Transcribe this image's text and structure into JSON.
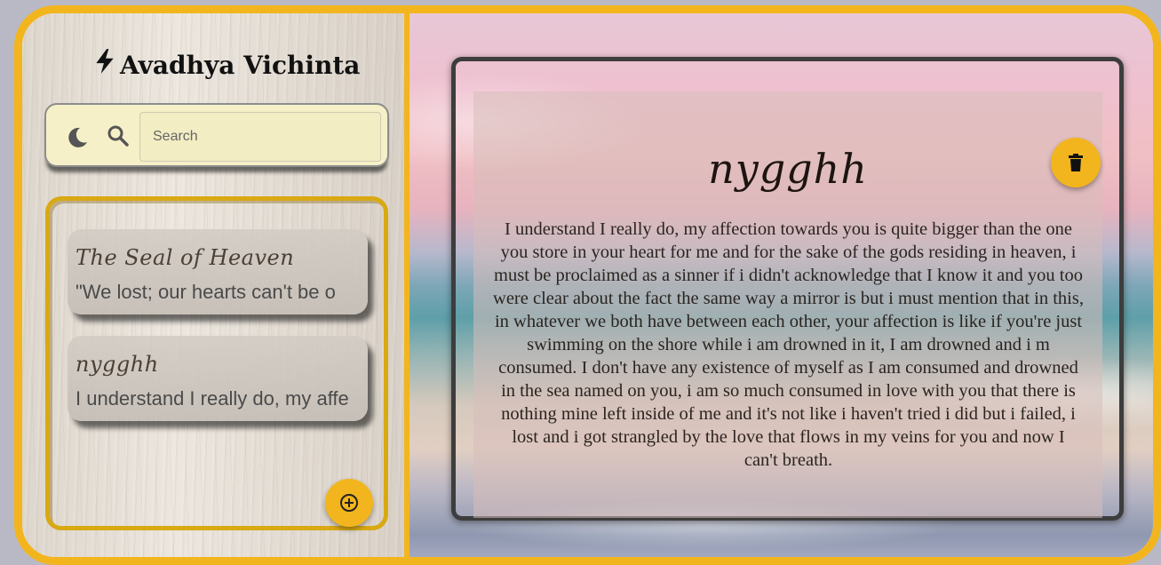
{
  "app": {
    "brand_title": "Avadhya Vichinta",
    "brand_icon": "lightning-bolt-icon"
  },
  "search": {
    "placeholder": "Search",
    "value": "",
    "theme_icon": "moon-icon",
    "search_icon": "search-icon"
  },
  "notes": [
    {
      "title": "The Seal of Heaven",
      "preview": "\"We lost; our hearts can't be o"
    },
    {
      "title": "nygghh",
      "preview": "I understand I really do, my affe"
    }
  ],
  "add_button": {
    "icon": "plus-circle-icon"
  },
  "editor": {
    "title": "nygghh",
    "body": "I understand I really do, my affection towards you is quite bigger than the one you store in your heart for me and for the sake of the gods residing in heaven, i must be proclaimed as a sinner if i didn't acknowledge that I know it and you too were clear about the fact the same way a mirror is but i must mention that in this, in whatever we both have between each other, your affection is like if you're just swimming on the shore while i am drowned in it, I am drowned and i m consumed. I don't have any existence of myself as I am consumed and drowned in the sea named on you, i am so much consumed in love with you that there is nothing mine left inside of me and it's not like i haven't tried i did but i failed, i lost and i got strangled by the love that flows in my veins for you and now I can't breath.",
    "delete_icon": "trash-icon"
  },
  "colors": {
    "accent": "#f2b51d",
    "search_bg": "#f6f0c8"
  }
}
